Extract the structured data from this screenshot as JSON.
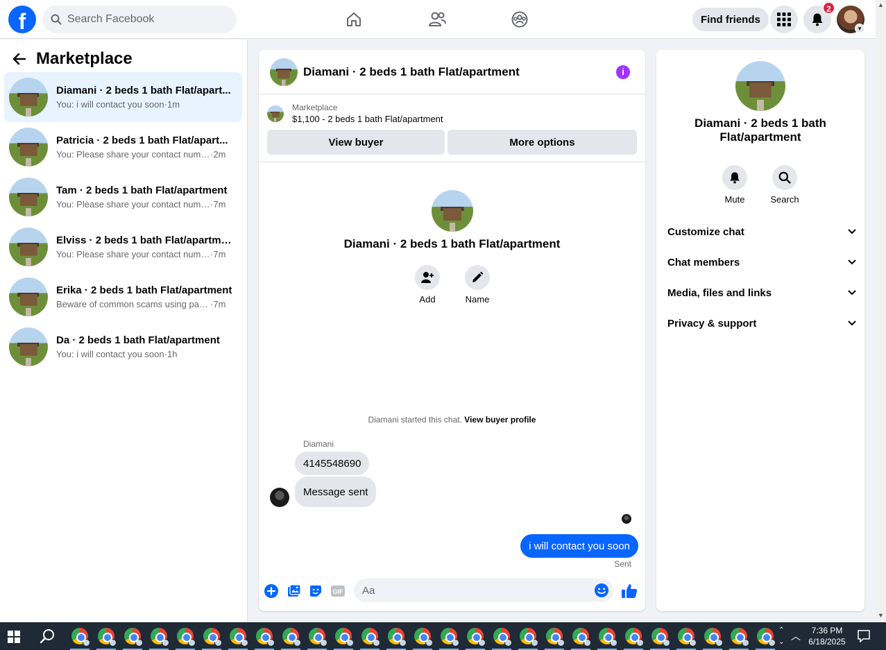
{
  "topbar": {
    "logo": "f",
    "search_placeholder": "Search Facebook",
    "nav_icons": [
      "home-icon",
      "friends-icon",
      "groups-icon"
    ],
    "find_friends": "Find friends",
    "notifications_count": "2"
  },
  "sidebar": {
    "title": "Marketplace",
    "conversations": [
      {
        "name": "Diamani · 2 beds 1 bath Flat/apart...",
        "preview": "You: i will contact you soon",
        "time": "1m",
        "active": true
      },
      {
        "name": "Patricia · 2 beds 1 bath Flat/apart...",
        "preview": "You: Please share your contact numb...",
        "time": "2m"
      },
      {
        "name": "Tam · 2 beds 1 bath Flat/apartment",
        "preview": "You: Please share your contact numb...",
        "time": "7m"
      },
      {
        "name": "Elviss · 2 beds 1 bath Flat/apartment",
        "preview": "You: Please share your contact numb...",
        "time": "7m"
      },
      {
        "name": "Erika · 2 beds 1 bath Flat/apartment",
        "preview": "Beware of common scams using pay...",
        "time": "7m"
      },
      {
        "name": "Da · 2 beds 1 bath Flat/apartment",
        "preview": "You: i will contact you soon",
        "time": "1h"
      }
    ]
  },
  "chat": {
    "title": "Diamani · 2 beds 1 bath Flat/apartment",
    "marketplace_label": "Marketplace",
    "listing": "$1,100 - 2 beds 1 bath Flat/apartment",
    "view_buyer": "View buyer",
    "more_options": "More options",
    "center_name": "Diamani · 2 beds 1 bath Flat/apartment",
    "add_label": "Add",
    "name_label": "Name",
    "started_text": "Diamani started this chat.",
    "view_buyer_profile": "View buyer profile",
    "sender": "Diamani",
    "messages_in": [
      "4145548690",
      "Message sent"
    ],
    "message_out": "i will contact you soon",
    "sent_status": "Sent",
    "composer_placeholder": "Aa"
  },
  "details": {
    "title": "Diamani · 2 beds 1 bath Flat/apartment",
    "mute": "Mute",
    "search": "Search",
    "sections": [
      "Customize chat",
      "Chat members",
      "Media, files and links",
      "Privacy & support"
    ]
  },
  "taskbar": {
    "time": "7:36 PM",
    "date": "6/18/2025"
  },
  "colors": {
    "brand": "#0866ff",
    "info": "#a033ff",
    "badge": "#e41e3f",
    "active_row": "#e7f3ff"
  }
}
